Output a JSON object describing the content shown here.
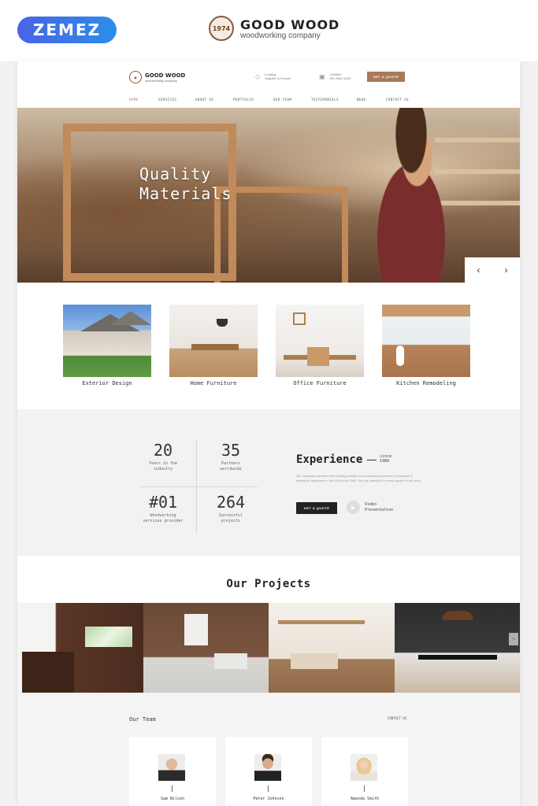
{
  "marketplace": {
    "logo_text": "ZEMEZ"
  },
  "brand": {
    "badge_year": "1974",
    "name": "GOOD WOOD",
    "tagline": "woodworking company"
  },
  "header": {
    "logo_name": "GOOD WOOD",
    "logo_tagline": "woodworking company",
    "info_leading": [
      "Leading",
      "Supplier in Europe"
    ],
    "info_certified": [
      "Certified",
      "ISO 9001:2000"
    ],
    "quote_button": "GET A QUOTE"
  },
  "nav": {
    "items": [
      {
        "label": "HOME"
      },
      {
        "label": "SERVICES"
      },
      {
        "label": "ABOUT US"
      },
      {
        "label": "PORTFOLIO"
      },
      {
        "label": "OUR TEAM"
      },
      {
        "label": "TESTIMONIALS"
      },
      {
        "label": "NEWS"
      },
      {
        "label": "CONTACT US"
      }
    ]
  },
  "hero": {
    "title_line1": "Quality",
    "title_line2": "Materials",
    "prev_icon": "‹",
    "next_icon": "›"
  },
  "services": [
    {
      "label": "Exterior Design"
    },
    {
      "label": "Home Furniture"
    },
    {
      "label": "Office Furniture"
    },
    {
      "label": "Kitchen Remodeling"
    }
  ],
  "stats": [
    {
      "number": "20",
      "caption_line1": "Years in the",
      "caption_line2": "industry"
    },
    {
      "number": "35",
      "caption_line1": "Partners",
      "caption_line2": "worldwide"
    },
    {
      "number": "#01",
      "caption_line1": "Woodworking",
      "caption_line2": "services provider"
    },
    {
      "number": "264",
      "caption_line1": "Successful",
      "caption_line2": "projects"
    }
  ],
  "experience": {
    "title": "Experience",
    "since_line1": "since",
    "since_line2": "1980",
    "paragraph": "Our company has been the leading provider of woodworking services to business & individual customers in the USA since 1980. We pay attention to every aspect of our work.",
    "quote_button": "GET A QUOTE",
    "video_line1": "Video",
    "video_line2": "Presentation"
  },
  "projects": {
    "title": "Our Projects",
    "next_icon": "›"
  },
  "team": {
    "title": "Our Team",
    "contact_link": "CONTACT US",
    "members": [
      {
        "name": "Sam Wilson"
      },
      {
        "name": "Peter Johnson"
      },
      {
        "name": "Amanda Smith"
      }
    ]
  }
}
